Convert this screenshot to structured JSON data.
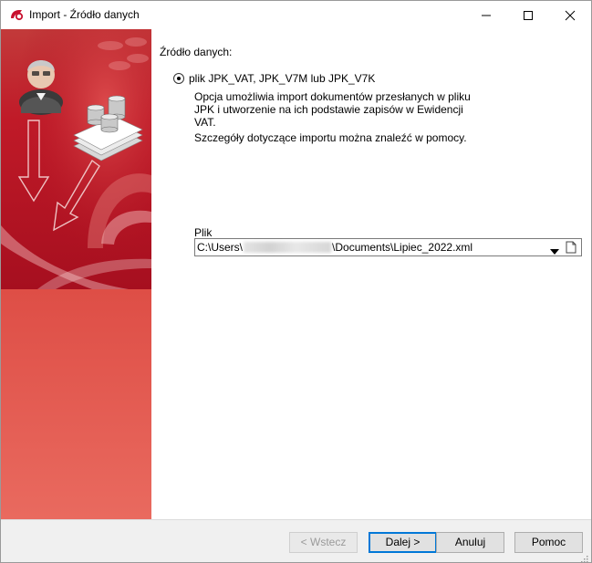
{
  "window": {
    "title": "Import - Źródło danych"
  },
  "content": {
    "section_label": "Źródło danych:",
    "option_label": "plik JPK_VAT, JPK_V7M lub JPK_V7K",
    "description": "Opcja umożliwia import dokumentów przesłanych w pliku JPK i utworzenie na ich podstawie zapisów w Ewidencji VAT.",
    "help_note": "Szczegóły dotyczące importu można znaleźć w pomocy.",
    "file": {
      "label": "Plik",
      "path_prefix": "C:\\Users\\",
      "path_suffix": "\\Documents\\Lipiec_2022.xml"
    }
  },
  "buttons": {
    "back": "< Wstecz",
    "next": "Dalej >",
    "cancel": "Anuluj",
    "help": "Pomoc"
  },
  "colors": {
    "sidebar": "#e5564c",
    "sidebar_dark": "#b5152a",
    "focus": "#0078d7"
  }
}
